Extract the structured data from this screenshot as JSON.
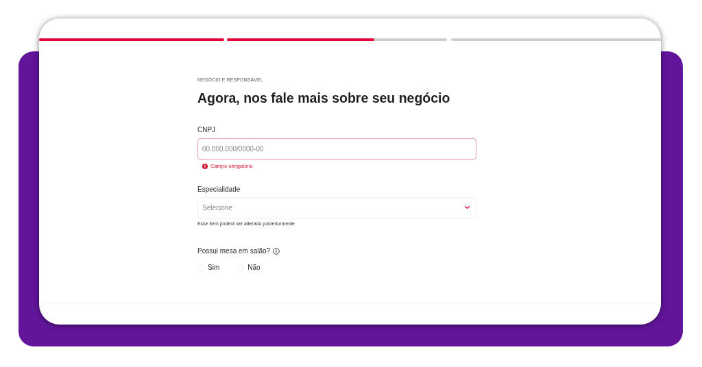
{
  "progress": {
    "steps": [
      {
        "done": true
      },
      {
        "done": false,
        "level": 0.67
      },
      {
        "done": false
      }
    ]
  },
  "form": {
    "section": "NEGÓCIO E RESPONSÁVEL",
    "title": "Agora, nos fale mais sobre seu negócio",
    "fields": [
      {
        "kind": "text",
        "label": "CNPJ",
        "placeholder": "00.000.000/0000-00",
        "invalid": true,
        "error": "Campo obrigatório"
      },
      {
        "kind": "select",
        "label": "Especialidade",
        "placeholder": "Selecione",
        "helper": "Esse item poderá ser alterado posteriormente"
      },
      {
        "kind": "radio",
        "label": "Possui mesa em salão?",
        "info": true,
        "options": [
          {
            "label": "Sim",
            "selected": false
          },
          {
            "label": "Não",
            "selected": false
          }
        ]
      }
    ]
  }
}
